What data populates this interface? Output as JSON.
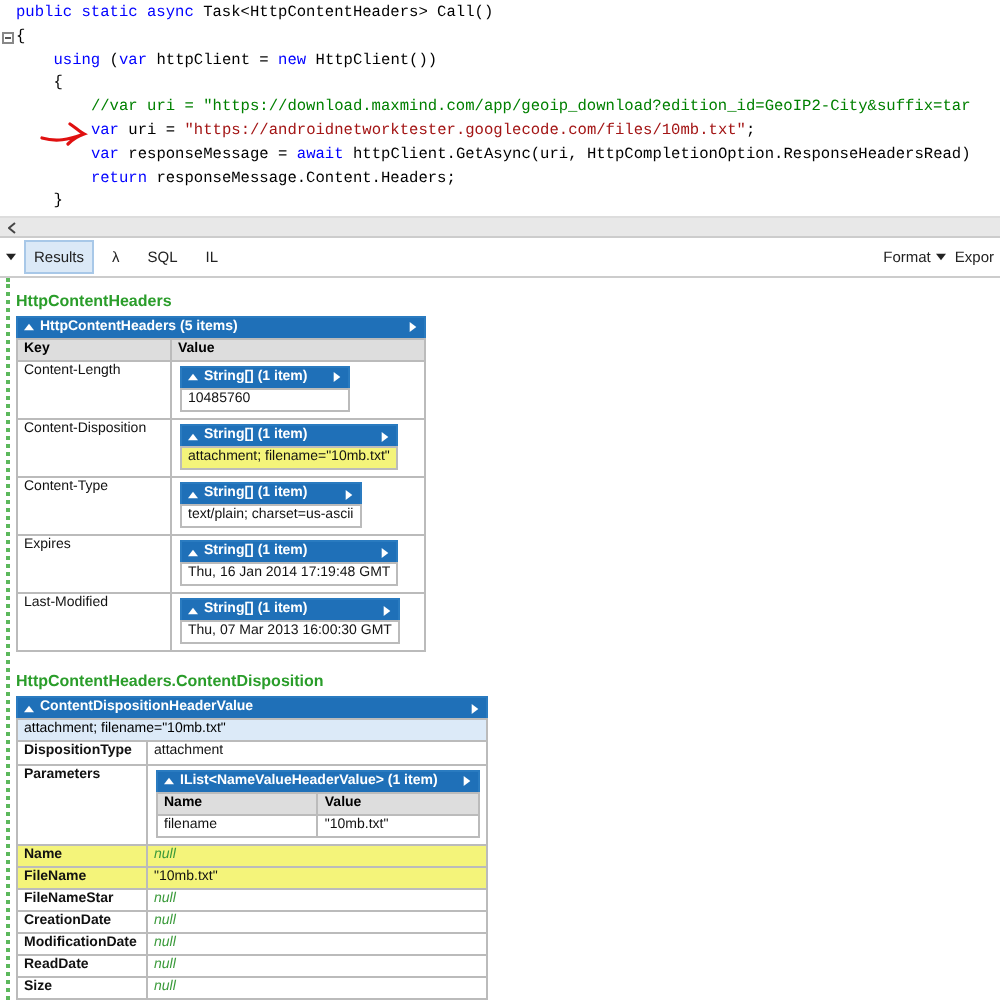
{
  "editor": {
    "lines": [
      {
        "tokens": [
          {
            "kind": "keyword",
            "text": "public static async "
          },
          {
            "kind": "plain",
            "text": "Task<HttpContentHeaders> Call()"
          }
        ]
      },
      {
        "tokens": [
          {
            "kind": "plain",
            "text": "{"
          }
        ]
      },
      {
        "tokens": [
          {
            "kind": "keyword",
            "text": "    using"
          },
          {
            "kind": "plain",
            "text": " ("
          },
          {
            "kind": "keyword",
            "text": "var"
          },
          {
            "kind": "plain",
            "text": " httpClient = "
          },
          {
            "kind": "keyword",
            "text": "new"
          },
          {
            "kind": "plain",
            "text": " HttpClient())"
          }
        ]
      },
      {
        "tokens": [
          {
            "kind": "plain",
            "text": "    {"
          }
        ]
      },
      {
        "tokens": [
          {
            "kind": "comment",
            "text": "        //var uri = \"https://download.maxmind.com/app/geoip_download?edition_id=GeoIP2-City&suffix=tar"
          }
        ]
      },
      {
        "tokens": [
          {
            "kind": "keyword",
            "text": "        var"
          },
          {
            "kind": "plain",
            "text": " uri = "
          },
          {
            "kind": "string",
            "text": "\"https://androidnetworktester.googlecode.com/files/10mb.txt\""
          },
          {
            "kind": "plain",
            "text": ";"
          }
        ]
      },
      {
        "tokens": [
          {
            "kind": "keyword",
            "text": "        var"
          },
          {
            "kind": "plain",
            "text": " responseMessage = "
          },
          {
            "kind": "keyword",
            "text": "await"
          },
          {
            "kind": "plain",
            "text": " httpClient.GetAsync(uri, HttpCompletionOption.ResponseHeadersRead)"
          }
        ]
      },
      {
        "tokens": [
          {
            "kind": "keyword",
            "text": "        return"
          },
          {
            "kind": "plain",
            "text": " responseMessage.Content.Headers;"
          }
        ]
      },
      {
        "tokens": [
          {
            "kind": "plain",
            "text": "    }"
          }
        ]
      }
    ]
  },
  "toolbar": {
    "tabs": [
      {
        "label": "Results",
        "selected": true
      },
      {
        "label": "λ",
        "selected": false
      },
      {
        "label": "SQL",
        "selected": false
      },
      {
        "label": "IL",
        "selected": false
      }
    ],
    "menus": [
      {
        "label": "Format"
      },
      {
        "label": "Expor"
      }
    ]
  },
  "headers_section": {
    "title": "HttpContentHeaders",
    "header": "HttpContentHeaders (5 items)",
    "columns": [
      "Key",
      "Value"
    ],
    "rows": [
      {
        "key": "Content-Length",
        "header": "String[] (1 item)",
        "value": "10485760",
        "highlighted": false
      },
      {
        "key": "Content-Disposition",
        "header": "String[] (1 item)",
        "value": "attachment; filename=\"10mb.txt\"",
        "highlighted": true
      },
      {
        "key": "Content-Type",
        "header": "String[] (1 item)",
        "value": "text/plain; charset=us-ascii",
        "highlighted": false
      },
      {
        "key": "Expires",
        "header": "String[] (1 item)",
        "value": "Thu, 16 Jan 2014 17:19:48 GMT",
        "highlighted": false
      },
      {
        "key": "Last-Modified",
        "header": "String[] (1 item)",
        "value": "Thu, 07 Mar 2013 16:00:30 GMT",
        "highlighted": false
      }
    ]
  },
  "disposition_section": {
    "title": "HttpContentHeaders.ContentDisposition",
    "header": "ContentDispositionHeaderValue",
    "summary": "attachment; filename=\"10mb.txt\"",
    "rows": [
      {
        "key": "DispositionType",
        "kind": "text",
        "value": "attachment",
        "highlighted": false
      },
      {
        "key": "Parameters",
        "kind": "table",
        "highlighted": false,
        "table": {
          "header": "IList<NameValueHeaderValue> (1 item)",
          "columns": [
            "Name",
            "Value"
          ],
          "rows": [
            [
              "filename",
              "\"10mb.txt\""
            ]
          ]
        }
      },
      {
        "key": "Name",
        "kind": "null",
        "value": "null",
        "highlighted": true
      },
      {
        "key": "FileName",
        "kind": "text",
        "value": "\"10mb.txt\"",
        "highlighted": true
      },
      {
        "key": "FileNameStar",
        "kind": "null",
        "value": "null",
        "highlighted": false
      },
      {
        "key": "CreationDate",
        "kind": "null",
        "value": "null",
        "highlighted": false
      },
      {
        "key": "ModificationDate",
        "kind": "null",
        "value": "null",
        "highlighted": false
      },
      {
        "key": "ReadDate",
        "kind": "null",
        "value": "null",
        "highlighted": false
      },
      {
        "key": "Size",
        "kind": "null",
        "value": "null",
        "highlighted": false
      }
    ]
  }
}
